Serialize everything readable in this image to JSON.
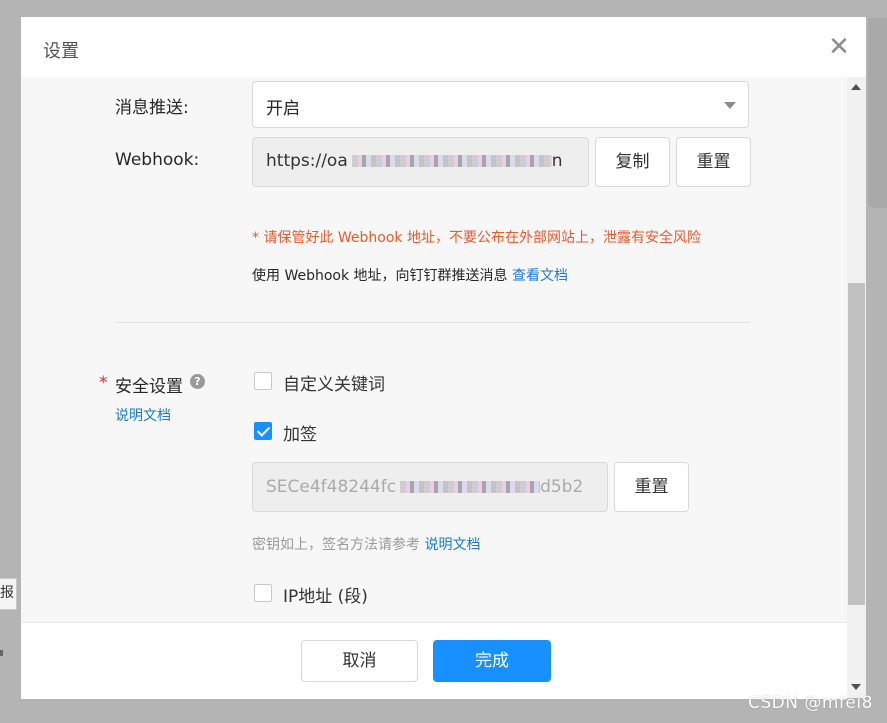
{
  "background": {
    "edge_text": "报",
    "watermark": "CSDN @mfei8"
  },
  "dialog": {
    "title": "设置",
    "close_icon": "close-icon"
  },
  "push": {
    "label": "消息推送:",
    "value": "开启"
  },
  "webhook": {
    "label": "Webhook:",
    "url_prefix": "https://oa",
    "url_suffix": "n",
    "copy_label": "复制",
    "reset_label": "重置",
    "warning": "* 请保管好此 Webhook 地址，不要公布在外部网站上，泄露有安全风险",
    "usage": "使用 Webhook 地址，向钉钉群推送消息",
    "usage_link": "查看文档"
  },
  "security": {
    "required_mark": "*",
    "label": "安全设置",
    "help_icon": "question-circle-icon",
    "doc_link": "说明文档",
    "keyword": {
      "label": "自定义关键词",
      "checked": false
    },
    "sign": {
      "label": "加签",
      "checked": true
    },
    "secret_prefix": "SECe4f48244fc",
    "secret_suffix": "d5b2",
    "reset_label": "重置",
    "secret_hint": "密钥如上，签名方法请参考",
    "secret_hint_link": "说明文档",
    "ip": {
      "label": "IP地址 (段)",
      "checked": false
    }
  },
  "footer": {
    "cancel_label": "取消",
    "done_label": "完成"
  },
  "colors": {
    "primary": "#1890ff",
    "warning": "#e85c2b",
    "link": "#1a7ad9",
    "required": "#f5222d"
  }
}
